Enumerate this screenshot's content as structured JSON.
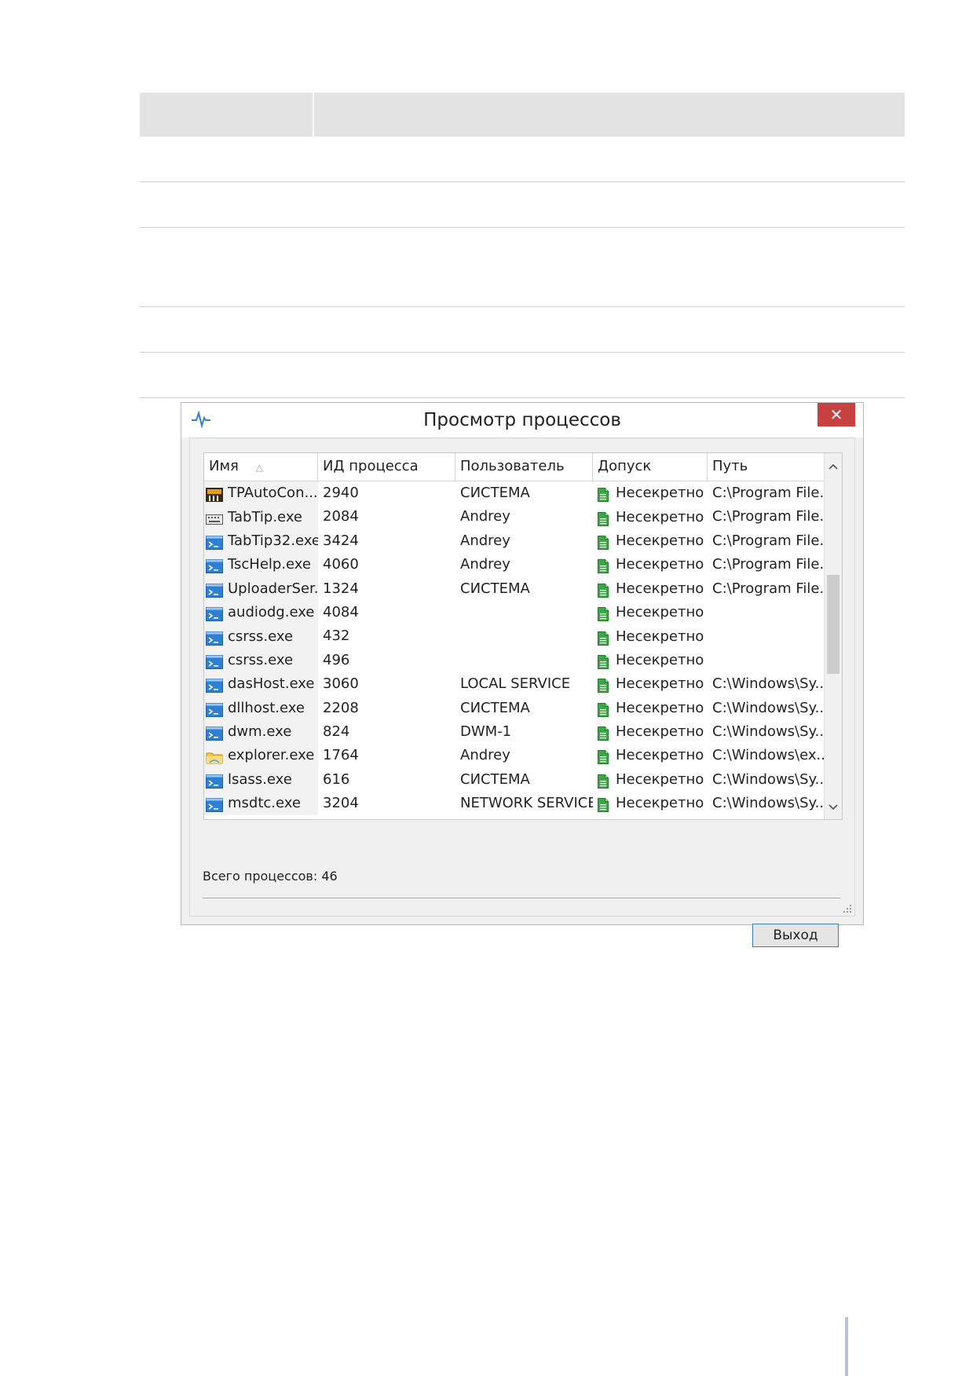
{
  "window": {
    "title": "Просмотр процессов",
    "close_label": "✕"
  },
  "table": {
    "columns": [
      "Имя",
      "ИД процесса",
      "Пользователь",
      "Допуск",
      "Путь"
    ],
    "sort_indicator": "△",
    "rows": [
      {
        "name": "TPAutoCon...",
        "pid": "2940",
        "user": "СИСТЕМА",
        "access": "Несекретно",
        "path": "C:\\Program File...",
        "icon": "tp-icon"
      },
      {
        "name": "TabTip.exe",
        "pid": "2084",
        "user": "Andrey",
        "access": "Несекретно",
        "path": "C:\\Program File...",
        "icon": "keyboard-icon"
      },
      {
        "name": "TabTip32.exe",
        "pid": "3424",
        "user": "Andrey",
        "access": "Несекретно",
        "path": "C:\\Program File...",
        "icon": "console-icon"
      },
      {
        "name": "TscHelp.exe",
        "pid": "4060",
        "user": "Andrey",
        "access": "Несекретно",
        "path": "C:\\Program File...",
        "icon": "console-icon"
      },
      {
        "name": "UploaderSer...",
        "pid": "1324",
        "user": "СИСТЕМА",
        "access": "Несекретно",
        "path": "C:\\Program File...",
        "icon": "console-icon"
      },
      {
        "name": "audiodg.exe",
        "pid": "4084",
        "user": "",
        "access": "Несекретно",
        "path": "",
        "icon": "console-icon"
      },
      {
        "name": "csrss.exe",
        "pid": "432",
        "user": "",
        "access": "Несекретно",
        "path": "",
        "icon": "console-icon"
      },
      {
        "name": "csrss.exe",
        "pid": "496",
        "user": "",
        "access": "Несекретно",
        "path": "",
        "icon": "console-icon"
      },
      {
        "name": "dasHost.exe",
        "pid": "3060",
        "user": "LOCAL SERVICE",
        "access": "Несекретно",
        "path": "C:\\Windows\\Sy...",
        "icon": "console-icon"
      },
      {
        "name": "dllhost.exe",
        "pid": "2208",
        "user": "СИСТЕМА",
        "access": "Несекретно",
        "path": "C:\\Windows\\Sy...",
        "icon": "console-icon"
      },
      {
        "name": "dwm.exe",
        "pid": "824",
        "user": "DWM-1",
        "access": "Несекретно",
        "path": "C:\\Windows\\Sy...",
        "icon": "console-icon"
      },
      {
        "name": "explorer.exe",
        "pid": "1764",
        "user": "Andrey",
        "access": "Несекретно",
        "path": "C:\\Windows\\ex...",
        "icon": "folder-icon"
      },
      {
        "name": "lsass.exe",
        "pid": "616",
        "user": "СИСТЕМА",
        "access": "Несекретно",
        "path": "C:\\Windows\\Sy...",
        "icon": "console-icon"
      },
      {
        "name": "msdtc.exe",
        "pid": "3204",
        "user": "NETWORK SERVICE",
        "access": "Несекретно",
        "path": "C:\\Windows\\Sy...",
        "icon": "console-icon"
      }
    ]
  },
  "scrollbar": {
    "up": "^",
    "down": "v"
  },
  "footer": {
    "count_text": "Всего процессов: 46",
    "exit_label": "Выход"
  },
  "colors": {
    "close": "#c74141",
    "access_icon": "#2e9a3a",
    "console_icon": "#2f7fd4"
  }
}
